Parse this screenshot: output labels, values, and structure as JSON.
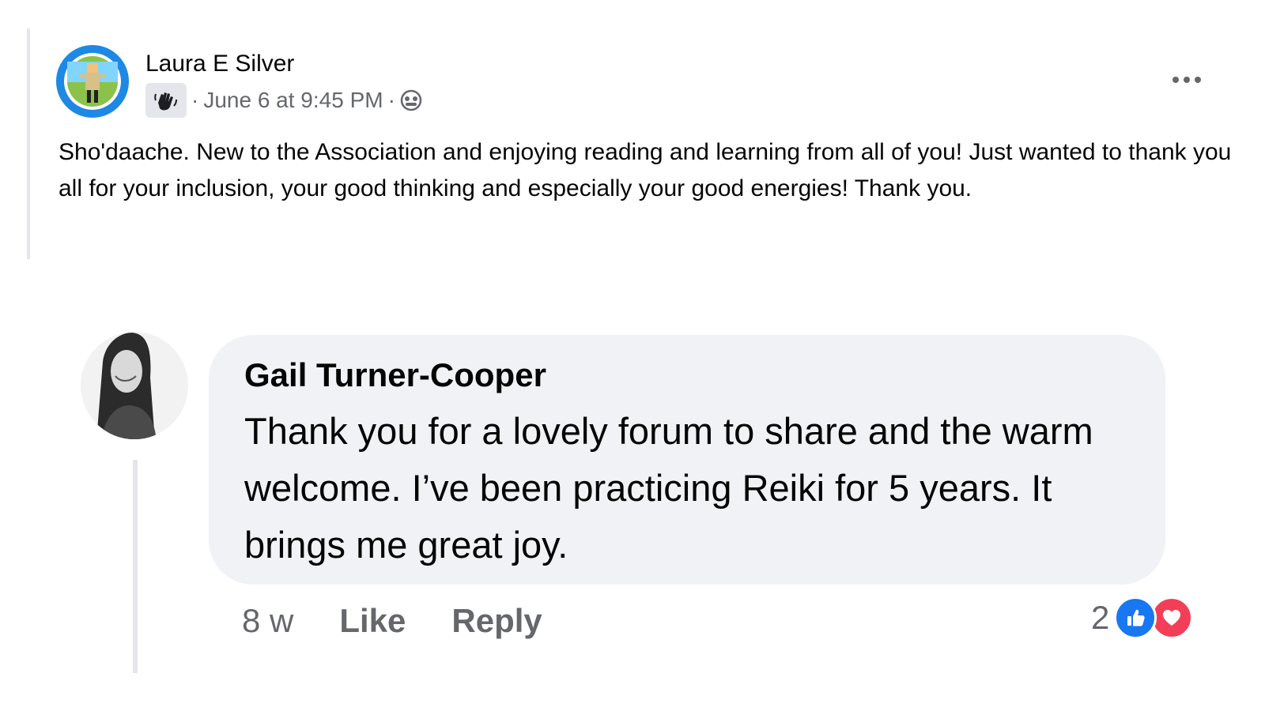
{
  "post": {
    "author": "Laura E Silver",
    "date": "June 6 at 9:45 PM",
    "separator": "·",
    "badge_icon": "waving-hand-badge-icon",
    "audience_icon": "group-audience-icon",
    "body": "Sho'daache. New to the Association and enjoying reading and learning from all of you! Just wanted to thank you all for your inclusion, your good thinking and especially your good energies! Thank you.",
    "more_icon": "more-options-icon"
  },
  "comment": {
    "author": "Gail Turner-Cooper",
    "text": "Thank you for a lovely forum to share and the warm welcome. I’ve been practicing Reiki for 5 years. It brings me great joy.",
    "time": "8 w",
    "like_label": "Like",
    "reply_label": "Reply",
    "reaction_count": "2",
    "reactions": [
      "like-reaction-icon",
      "love-reaction-icon"
    ]
  },
  "colors": {
    "text_primary": "#050505",
    "text_secondary": "#65676b",
    "bubble_bg": "#f0f2f5",
    "rail": "#e4e6eb",
    "like_blue": "#1877f2",
    "love_red": "#f33e58"
  }
}
